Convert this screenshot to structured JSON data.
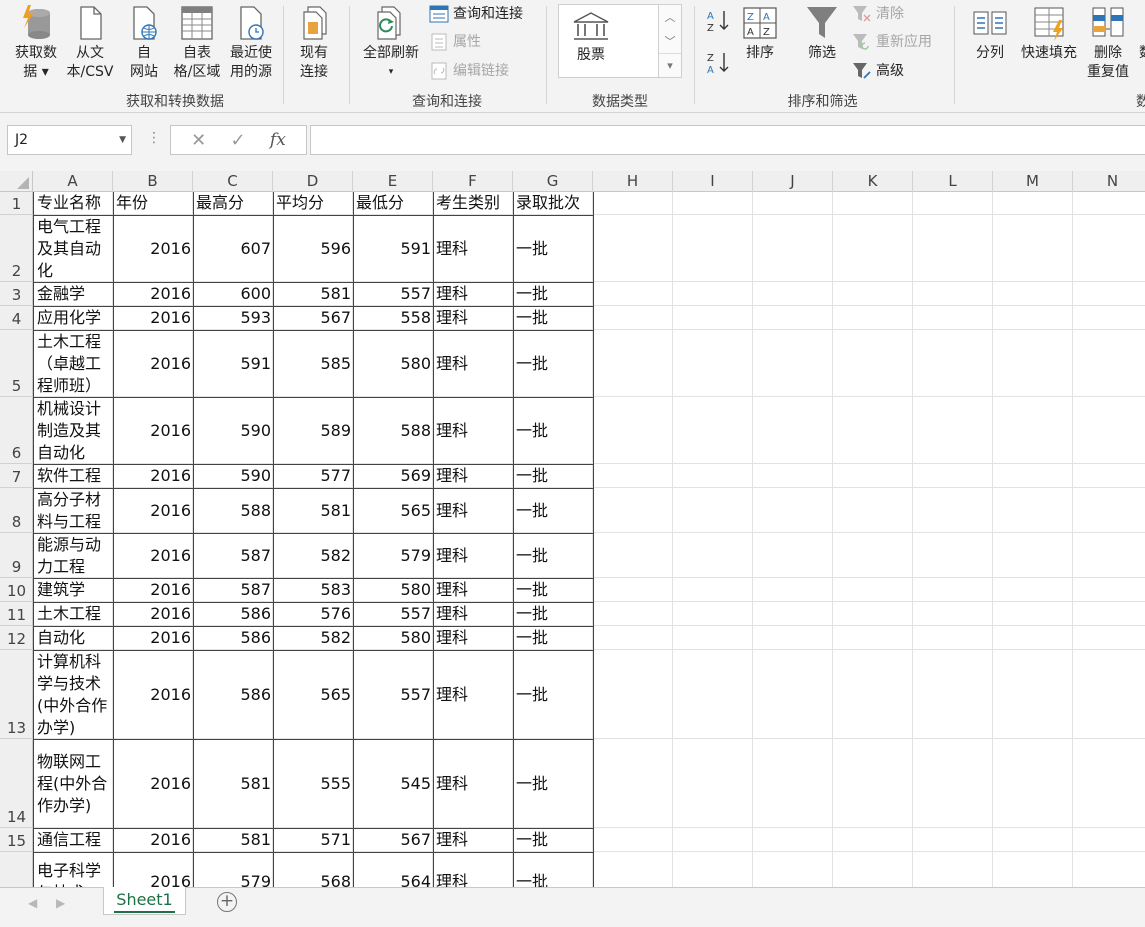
{
  "ribbon": {
    "get_data": {
      "line1": "获取数",
      "line2": "据 ▾",
      "icon": "database-lightning-icon"
    },
    "from_csv": {
      "line1": "从文",
      "line2": "本/CSV",
      "icon": "text-file-icon"
    },
    "from_web": {
      "line1": "自",
      "line2": "网站",
      "icon": "web-page-icon"
    },
    "from_table": {
      "line1": "自表",
      "line2": "格/区域",
      "icon": "table-grid-icon"
    },
    "recent_sources": {
      "line1": "最近使",
      "line2": "用的源",
      "icon": "recent-file-clock-icon"
    },
    "existing_conn": {
      "line1": "现有",
      "line2": "连接",
      "icon": "file-stack-icon"
    },
    "group_get_transform": "获取和转换数据",
    "refresh_all": {
      "line1": "全部刷新",
      "line2": "▾",
      "icon": "refresh-all-icon"
    },
    "queries_conn": "查询和连接",
    "properties": "属性",
    "edit_links": "编辑链接",
    "group_queries": "查询和连接",
    "data_type_stocks": "股票",
    "group_data_types": "数据类型",
    "sort_asc_icon": "sort-az-icon",
    "sort_desc_icon": "sort-za-icon",
    "sort": "排序",
    "filter": "筛选",
    "clear": "清除",
    "reapply": "重新应用",
    "advanced": "高级",
    "group_sort_filter": "排序和筛选",
    "text_to_columns": "分列",
    "flash_fill": "快速填充",
    "remove_dup": {
      "line1": "删除",
      "line2": "重复值"
    },
    "data_validation_partial": "数",
    "group_data_tools_partial": "数"
  },
  "formula_bar": {
    "name_box": "J2",
    "fx": "fx",
    "formula": ""
  },
  "columns": [
    "A",
    "B",
    "C",
    "D",
    "E",
    "F",
    "G",
    "H",
    "I",
    "J",
    "K",
    "L",
    "M",
    "N"
  ],
  "sheet": {
    "header": [
      "专业名称",
      "年份",
      "最高分",
      "平均分",
      "最低分",
      "考生类别",
      "录取批次"
    ],
    "rows": [
      {
        "n": "2",
        "cells": [
          "电气工程及其自动化",
          "2016",
          "607",
          "596",
          "591",
          "理科",
          "一批"
        ]
      },
      {
        "n": "3",
        "cells": [
          "金融学",
          "2016",
          "600",
          "581",
          "557",
          "理科",
          "一批"
        ]
      },
      {
        "n": "4",
        "cells": [
          "应用化学",
          "2016",
          "593",
          "567",
          "558",
          "理科",
          "一批"
        ]
      },
      {
        "n": "5",
        "cells": [
          "土木工程（卓越工程师班）",
          "2016",
          "591",
          "585",
          "580",
          "理科",
          "一批"
        ]
      },
      {
        "n": "6",
        "cells": [
          "机械设计制造及其自动化",
          "2016",
          "590",
          "589",
          "588",
          "理科",
          "一批"
        ]
      },
      {
        "n": "7",
        "cells": [
          "软件工程",
          "2016",
          "590",
          "577",
          "569",
          "理科",
          "一批"
        ]
      },
      {
        "n": "8",
        "cells": [
          "高分子材料与工程",
          "2016",
          "588",
          "581",
          "565",
          "理科",
          "一批"
        ]
      },
      {
        "n": "9",
        "cells": [
          "能源与动力工程",
          "2016",
          "587",
          "582",
          "579",
          "理科",
          "一批"
        ]
      },
      {
        "n": "10",
        "cells": [
          "建筑学",
          "2016",
          "587",
          "583",
          "580",
          "理科",
          "一批"
        ]
      },
      {
        "n": "11",
        "cells": [
          "土木工程",
          "2016",
          "586",
          "576",
          "557",
          "理科",
          "一批"
        ]
      },
      {
        "n": "12",
        "cells": [
          "自动化",
          "2016",
          "586",
          "582",
          "580",
          "理科",
          "一批"
        ]
      },
      {
        "n": "13",
        "cells": [
          "计算机科学与技术(中外合作办学)",
          "2016",
          "586",
          "565",
          "557",
          "理科",
          "一批"
        ]
      },
      {
        "n": "14",
        "cells": [
          "物联网工程(中外合作办学)",
          "2016",
          "581",
          "555",
          "545",
          "理科",
          "一批"
        ]
      },
      {
        "n": "15",
        "cells": [
          "通信工程",
          "2016",
          "581",
          "571",
          "567",
          "理科",
          "一批"
        ]
      },
      {
        "n": "16",
        "cells": [
          "电子科学与技术",
          "2016",
          "579",
          "568",
          "564",
          "理科",
          "一批"
        ]
      }
    ]
  },
  "tabs": {
    "sheet1": "Sheet1",
    "add_icon": "plus-circle-icon"
  }
}
